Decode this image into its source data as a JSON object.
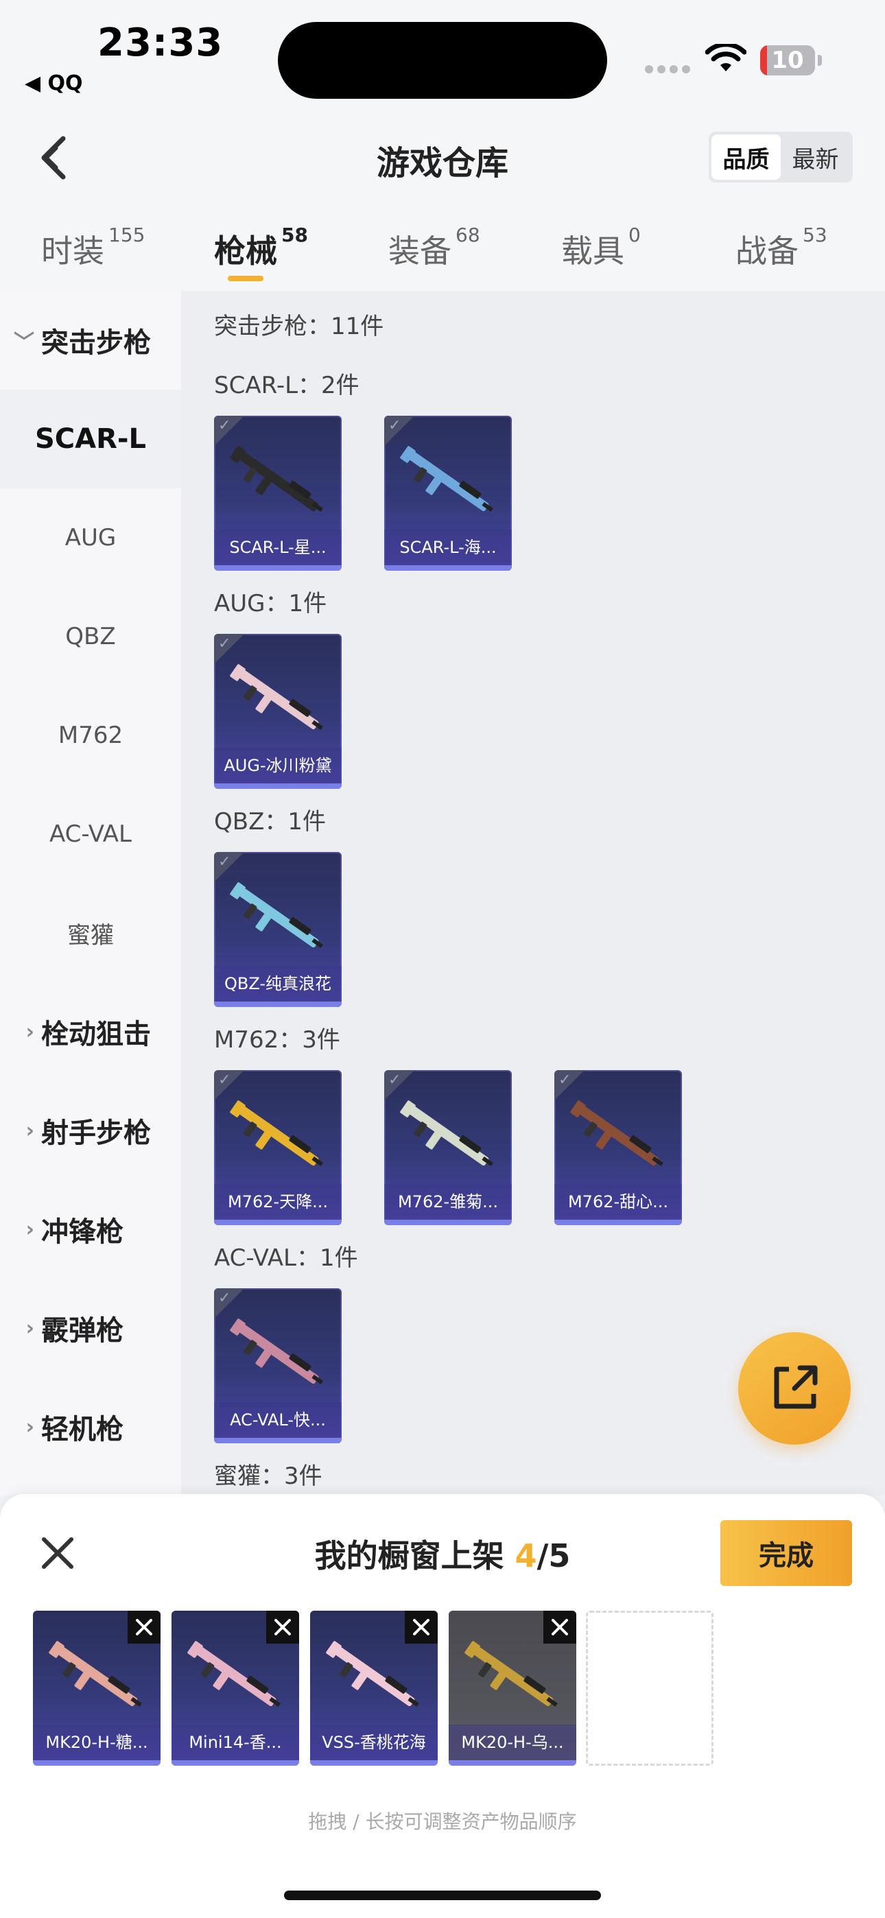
{
  "status_bar": {
    "time": "23:33",
    "back_app": "◀ QQ",
    "battery": "10"
  },
  "header": {
    "title": "游戏仓库",
    "sort_options": [
      "品质",
      "最新"
    ],
    "sort_selected": "品质"
  },
  "tabs": [
    {
      "label": "时装",
      "count": "155"
    },
    {
      "label": "枪械",
      "count": "58",
      "active": true
    },
    {
      "label": "装备",
      "count": "68"
    },
    {
      "label": "载具",
      "count": "0"
    },
    {
      "label": "战备",
      "count": "53"
    }
  ],
  "sidebar": {
    "expanded_category": "突击步枪",
    "sub_items": [
      "SCAR-L",
      "AUG",
      "QBZ",
      "M762",
      "AC-VAL",
      "蜜獾"
    ],
    "active_sub": "SCAR-L",
    "collapsed_categories": [
      "栓动狙击",
      "射手步枪",
      "冲锋枪",
      "霰弹枪",
      "轻机枪"
    ]
  },
  "content": {
    "category_summary": "突击步枪：11件",
    "groups": [
      {
        "label": "SCAR-L：2件",
        "items": [
          "SCAR-L-星...",
          "SCAR-L-海..."
        ]
      },
      {
        "label": "AUG：1件",
        "items": [
          "AUG-冰川粉黛"
        ]
      },
      {
        "label": "QBZ：1件",
        "items": [
          "QBZ-纯真浪花"
        ]
      },
      {
        "label": "M762：3件",
        "items": [
          "M762-天降...",
          "M762-雏菊...",
          "M762-甜心..."
        ]
      },
      {
        "label": "AC-VAL：1件",
        "items": [
          "AC-VAL-快..."
        ]
      },
      {
        "label": "蜜獾：3件",
        "items": []
      }
    ]
  },
  "panel": {
    "title_prefix": "我的橱窗上架 ",
    "count_current": "4",
    "count_total": "/5",
    "done_label": "完成",
    "shelf_items": [
      "MK20-H-糖...",
      "Mini14-香...",
      "VSS-香桃花海",
      "MK20-H-乌..."
    ],
    "hint": "拖拽 / 长按可调整资产物品顺序"
  },
  "colors": {
    "accent": "#f2b230",
    "card_purple": "#343a78",
    "page_bg": "#edeef2"
  },
  "icons": [
    "back-icon",
    "wifi-icon",
    "share-icon",
    "close-icon",
    "check-icon",
    "remove-icon"
  ]
}
